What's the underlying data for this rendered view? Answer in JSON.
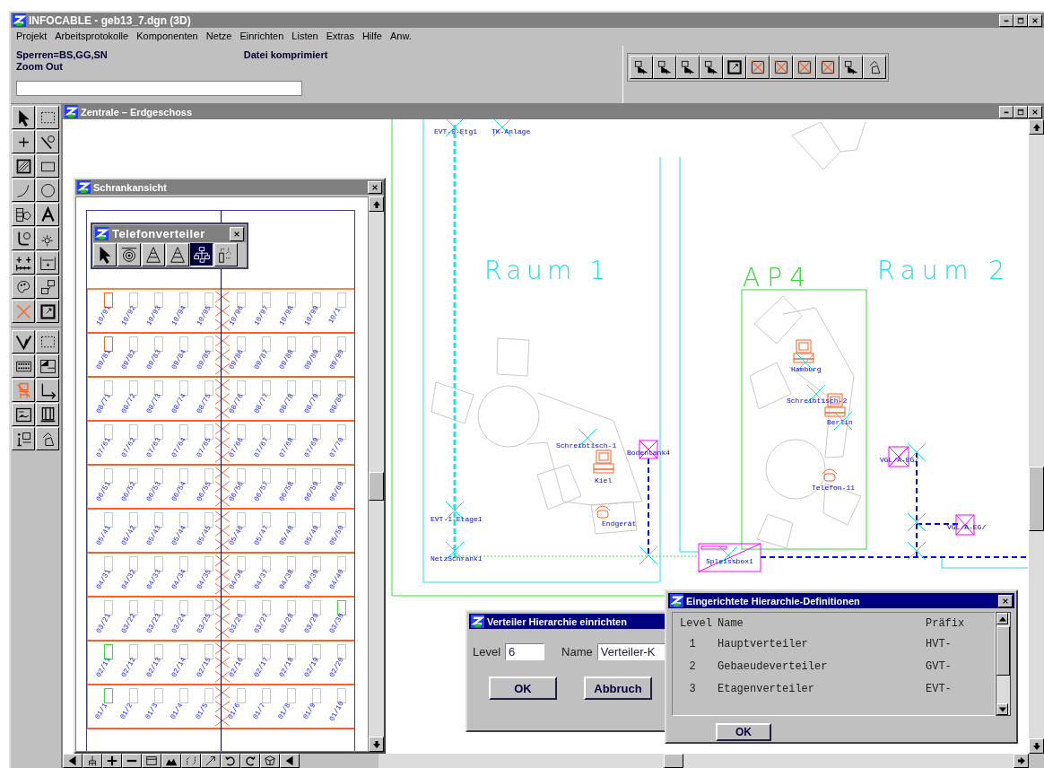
{
  "window": {
    "title": "INFOCABLE - geb13_7.dgn (3D)"
  },
  "menu": [
    "Projekt",
    "Arbeitsprotokolle",
    "Komponenten",
    "Netze",
    "Einrichten",
    "Listen",
    "Extras",
    "Hilfe",
    "Anw."
  ],
  "status": {
    "locks": "Sperren=BS,GG,SN",
    "command": "Zoom Out",
    "message": "Datei komprimiert"
  },
  "drawing_window": {
    "title": "Zentrale – Erdgeschoss",
    "labels": [
      {
        "text": "EVT-0-Etg1",
        "kind": "tag"
      },
      {
        "text": "TK-Anlage",
        "kind": "tag"
      },
      {
        "text": "Raum 1",
        "kind": "room"
      },
      {
        "text": "AP4",
        "kind": "zone"
      },
      {
        "text": "Raum 2",
        "kind": "room"
      },
      {
        "text": "Hamburg",
        "kind": "tag"
      },
      {
        "text": "Schreibtisch-2",
        "kind": "tag"
      },
      {
        "text": "Berlin",
        "kind": "tag"
      },
      {
        "text": "Schreibtisch-1",
        "kind": "tag"
      },
      {
        "text": "Bodentank4",
        "kind": "tag"
      },
      {
        "text": "Kiel",
        "kind": "tag"
      },
      {
        "text": "VGL/A-EG/",
        "kind": "tag"
      },
      {
        "text": "Telefon-11",
        "kind": "tag"
      },
      {
        "text": "EVT-1-Etage1",
        "kind": "tag"
      },
      {
        "text": "Endgerät",
        "kind": "tag"
      },
      {
        "text": "VGL/A-EG/",
        "kind": "tag"
      },
      {
        "text": "NetzSchrank1",
        "kind": "tag"
      },
      {
        "text": "Spleissbox1",
        "kind": "tag"
      }
    ]
  },
  "cabinet_view": {
    "title": "Schrankansicht",
    "palette": {
      "title": "Telefonverteiler",
      "tools": [
        {
          "selected": false
        },
        {
          "selected": false
        },
        {
          "selected": false
        },
        {
          "selected": false
        },
        {
          "selected": true
        },
        {
          "selected": false
        }
      ]
    },
    "rows": [
      {
        "ports": [
          {
            "label": "10/91",
            "color": "#ff6020"
          },
          {
            "label": "10/92",
            "color": "#c8c8c8"
          },
          {
            "label": "10/93",
            "color": "#c8c8c8"
          },
          {
            "label": "10/94",
            "color": "#c8c8c8"
          },
          {
            "label": "10/95",
            "color": "#c8c8c8"
          },
          {
            "label": "10/96",
            "color": "#c8c8c8"
          },
          {
            "label": "10/97",
            "color": "#c8c8c8"
          },
          {
            "label": "10/98",
            "color": "#c8c8c8"
          },
          {
            "label": "10/99",
            "color": "#c8c8c8"
          },
          {
            "label": "10/1",
            "color": "#c8c8c8"
          }
        ]
      },
      {
        "ports": [
          {
            "label": "09/81",
            "color": "#ff6020"
          },
          {
            "label": "09/82",
            "color": "#c8c8c8"
          },
          {
            "label": "09/83",
            "color": "#c8c8c8"
          },
          {
            "label": "09/84",
            "color": "#c8c8c8"
          },
          {
            "label": "09/85",
            "color": "#c8c8c8"
          },
          {
            "label": "09/86",
            "color": "#c8c8c8"
          },
          {
            "label": "09/87",
            "color": "#c8c8c8"
          },
          {
            "label": "09/88",
            "color": "#c8c8c8"
          },
          {
            "label": "09/89",
            "color": "#c8c8c8"
          },
          {
            "label": "09/90",
            "color": "#c8c8c8"
          }
        ]
      },
      {
        "ports": [
          {
            "label": "08/71",
            "color": "#c8c8c8"
          },
          {
            "label": "08/72",
            "color": "#c8c8c8"
          },
          {
            "label": "08/73",
            "color": "#c8c8c8"
          },
          {
            "label": "08/74",
            "color": "#c8c8c8"
          },
          {
            "label": "08/75",
            "color": "#c8c8c8"
          },
          {
            "label": "08/76",
            "color": "#c8c8c8"
          },
          {
            "label": "08/77",
            "color": "#c8c8c8"
          },
          {
            "label": "08/78",
            "color": "#c8c8c8"
          },
          {
            "label": "08/79",
            "color": "#c8c8c8"
          },
          {
            "label": "08/80",
            "color": "#c8c8c8"
          }
        ]
      },
      {
        "ports": [
          {
            "label": "07/61",
            "color": "#c8c8c8"
          },
          {
            "label": "07/62",
            "color": "#c8c8c8"
          },
          {
            "label": "07/63",
            "color": "#c8c8c8"
          },
          {
            "label": "07/64",
            "color": "#c8c8c8"
          },
          {
            "label": "07/65",
            "color": "#c8c8c8"
          },
          {
            "label": "07/66",
            "color": "#c8c8c8"
          },
          {
            "label": "07/67",
            "color": "#c8c8c8"
          },
          {
            "label": "07/68",
            "color": "#c8c8c8"
          },
          {
            "label": "07/69",
            "color": "#c8c8c8"
          },
          {
            "label": "07/70",
            "color": "#c8c8c8"
          }
        ]
      },
      {
        "ports": [
          {
            "label": "06/51",
            "color": "#c8c8c8"
          },
          {
            "label": "06/52",
            "color": "#c8c8c8"
          },
          {
            "label": "06/53",
            "color": "#c8c8c8"
          },
          {
            "label": "06/54",
            "color": "#c8c8c8"
          },
          {
            "label": "06/55",
            "color": "#c8c8c8"
          },
          {
            "label": "06/56",
            "color": "#c8c8c8"
          },
          {
            "label": "06/57",
            "color": "#c8c8c8"
          },
          {
            "label": "06/58",
            "color": "#c8c8c8"
          },
          {
            "label": "06/59",
            "color": "#c8c8c8"
          },
          {
            "label": "06/60",
            "color": "#c8c8c8"
          }
        ]
      },
      {
        "ports": [
          {
            "label": "05/41",
            "color": "#c8c8c8"
          },
          {
            "label": "05/42",
            "color": "#c8c8c8"
          },
          {
            "label": "05/43",
            "color": "#c8c8c8"
          },
          {
            "label": "05/44",
            "color": "#c8c8c8"
          },
          {
            "label": "05/45",
            "color": "#c8c8c8"
          },
          {
            "label": "05/46",
            "color": "#c8c8c8"
          },
          {
            "label": "05/47",
            "color": "#c8c8c8"
          },
          {
            "label": "05/48",
            "color": "#c8c8c8"
          },
          {
            "label": "05/49",
            "color": "#c8c8c8"
          },
          {
            "label": "05/50",
            "color": "#c8c8c8"
          }
        ]
      },
      {
        "ports": [
          {
            "label": "04/31",
            "color": "#c8c8c8"
          },
          {
            "label": "04/32",
            "color": "#c8c8c8"
          },
          {
            "label": "04/33",
            "color": "#c8c8c8"
          },
          {
            "label": "04/34",
            "color": "#c8c8c8"
          },
          {
            "label": "04/35",
            "color": "#c8c8c8"
          },
          {
            "label": "04/36",
            "color": "#c8c8c8"
          },
          {
            "label": "04/37",
            "color": "#c8c8c8"
          },
          {
            "label": "04/38",
            "color": "#c8c8c8"
          },
          {
            "label": "04/39",
            "color": "#c8c8c8"
          },
          {
            "label": "04/40",
            "color": "#c8c8c8"
          }
        ]
      },
      {
        "ports": [
          {
            "label": "03/21",
            "color": "#c8c8c8"
          },
          {
            "label": "03/22",
            "color": "#c8c8c8"
          },
          {
            "label": "03/23",
            "color": "#c8c8c8"
          },
          {
            "label": "03/24",
            "color": "#c8c8c8"
          },
          {
            "label": "03/25",
            "color": "#c8c8c8"
          },
          {
            "label": "03/26",
            "color": "#c8c8c8"
          },
          {
            "label": "03/27",
            "color": "#c8c8c8"
          },
          {
            "label": "03/28",
            "color": "#c8c8c8"
          },
          {
            "label": "03/29",
            "color": "#c8c8c8"
          },
          {
            "label": "03/30",
            "color": "#30e030"
          }
        ]
      },
      {
        "ports": [
          {
            "label": "02/11",
            "color": "#30e030"
          },
          {
            "label": "02/12",
            "color": "#c8c8c8"
          },
          {
            "label": "02/13",
            "color": "#c8c8c8"
          },
          {
            "label": "02/14",
            "color": "#c8c8c8"
          },
          {
            "label": "02/15",
            "color": "#c8c8c8"
          },
          {
            "label": "02/16",
            "color": "#c8c8c8"
          },
          {
            "label": "02/17",
            "color": "#c8c8c8"
          },
          {
            "label": "02/18",
            "color": "#c8c8c8"
          },
          {
            "label": "02/19",
            "color": "#c8c8c8"
          },
          {
            "label": "02/20",
            "color": "#c8c8c8"
          }
        ]
      },
      {
        "ports": [
          {
            "label": "01/1",
            "color": "#30e030"
          },
          {
            "label": "01/2",
            "color": "#c8c8c8"
          },
          {
            "label": "01/3",
            "color": "#c8c8c8"
          },
          {
            "label": "01/4",
            "color": "#c8c8c8"
          },
          {
            "label": "01/5",
            "color": "#c8c8c8"
          },
          {
            "label": "01/6",
            "color": "#c8c8c8"
          },
          {
            "label": "01/7",
            "color": "#c8c8c8"
          },
          {
            "label": "01/8",
            "color": "#c8c8c8"
          },
          {
            "label": "01/9",
            "color": "#c8c8c8"
          },
          {
            "label": "01/10",
            "color": "#c8c8c8"
          }
        ]
      }
    ]
  },
  "hierarchy_dialog": {
    "title": "Verteiler Hierarchie einrichten",
    "level_label": "Level",
    "level_value": "6",
    "name_label": "Name",
    "name_value": "Verteiler-K",
    "buttons": [
      "OK",
      "Abbruch"
    ]
  },
  "definitions_dialog": {
    "title": "Eingerichtete Hierarchie-Definitionen",
    "columns": [
      "Level",
      "Name",
      "Präfix"
    ],
    "rows": [
      [
        "1",
        "Hauptverteiler",
        "HVT-"
      ],
      [
        "2",
        "Gebaeudeverteiler",
        "GVT-"
      ],
      [
        "3",
        "Etagenverteiler",
        "EVT-"
      ]
    ],
    "button": "OK"
  }
}
